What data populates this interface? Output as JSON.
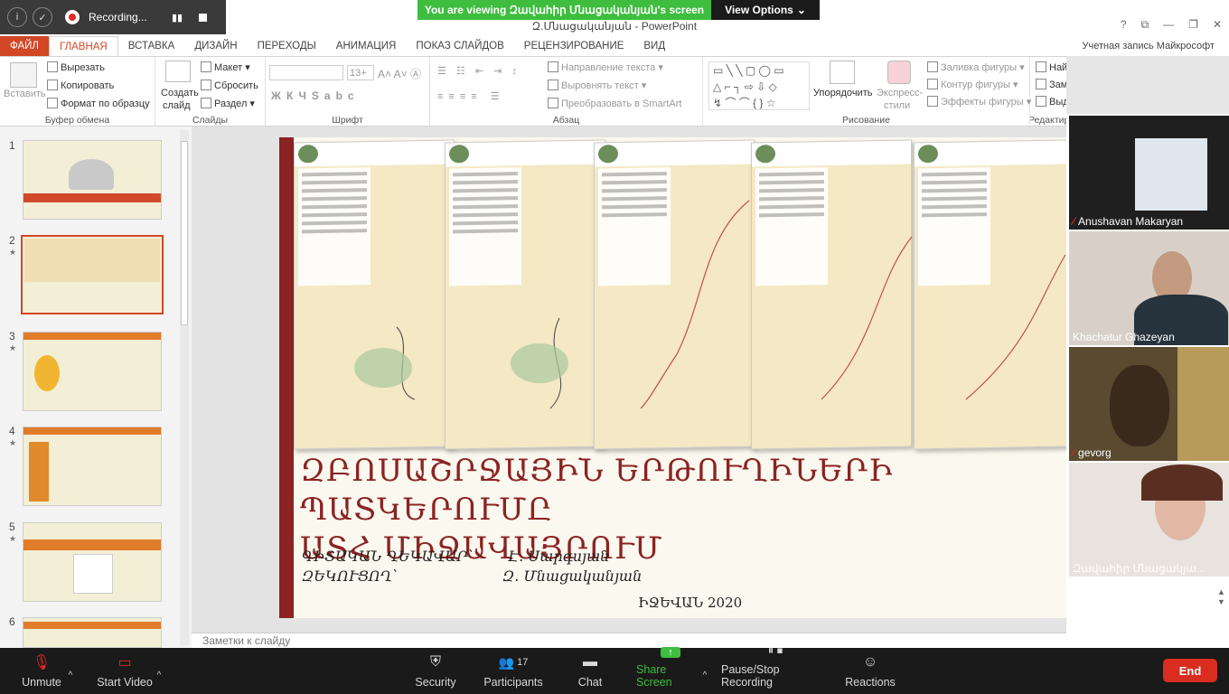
{
  "zoom": {
    "recording_label": "Recording...",
    "banner": "You are viewing Զավահիր Մնացականյան's screen",
    "view_options": "View Options",
    "toolbar": {
      "unmute": "Unmute",
      "start_video": "Start Video",
      "security": "Security",
      "participants": "Participants",
      "participants_count": "17",
      "chat": "Chat",
      "share_screen": "Share Screen",
      "pause_stop": "Pause/Stop Recording",
      "reactions": "Reactions",
      "end": "End"
    },
    "participants": [
      {
        "name": "Anushavan Makaryan",
        "muted": true
      },
      {
        "name": "Khachatur Ghazeyan",
        "muted": false
      },
      {
        "name": "gevorg",
        "muted": true
      },
      {
        "name": "Զավահիր Մնացակյա...",
        "muted": false
      }
    ],
    "accent_green": "#3ebd3e",
    "end_red": "#d92d20"
  },
  "ppt": {
    "doc_title": "Զ.Մնացականյան - PowerPoint",
    "account": "Учетная запись Майкрософт",
    "tabs": [
      "ФАЙЛ",
      "ГЛАВНАЯ",
      "ВСТАВКА",
      "ДИЗАЙН",
      "ПЕРЕХОДЫ",
      "АНИМАЦИЯ",
      "ПОКАЗ СЛАЙДОВ",
      "РЕЦЕНЗИРОВАНИЕ",
      "ВИД"
    ],
    "ribbon": {
      "clipboard": {
        "label": "Буфер обмена",
        "paste": "Вставить",
        "cut": "Вырезать",
        "copy": "Копировать",
        "format": "Формат по образцу"
      },
      "slides": {
        "label": "Слайды",
        "new_slide_1": "Создать",
        "new_slide_2": "слайд",
        "layout": "Макет",
        "reset": "Сбросить",
        "section": "Раздел"
      },
      "font": {
        "label": "Шрифт",
        "size": "13+"
      },
      "paragraph": {
        "label": "Абзац",
        "text_dir": "Направление текста",
        "align_text": "Выровнять текст",
        "smartart": "Преобразовать в SmartArt"
      },
      "drawing": {
        "label": "Рисование",
        "arrange": "Упорядочить",
        "styles_1": "Экспресс-",
        "styles_2": "стили",
        "fill": "Заливка фигуры",
        "outline": "Контур фигуры",
        "effects": "Эффекты фигуры"
      },
      "editing": {
        "label": "Редактир",
        "find": "Найти",
        "replace": "Заменить",
        "select": "Выделить"
      }
    },
    "slide_numbers": [
      "1",
      "2",
      "3",
      "4",
      "5",
      "6"
    ],
    "selected_slide": 2,
    "notes_placeholder": "Заметки к слайду",
    "accent": "#d24726"
  },
  "slide": {
    "title_line1": "ԶԲՈՍԱՇՐՋԱՅԻՆ ԵՐԹՈՒՂԻՆԵՐԻ ՊԱՏԿԵՐՈՒՄԸ",
    "title_line2": "ԱՏՀ ՄԻՋԱՎԱՅՐՈՒՄ",
    "supervisor_label": "ԳԻՏԱԿԱՆ ՂԵԿԱՎԱՐ՝",
    "supervisor_name": "Է. Սարգսյան",
    "author_label": "ԶԵԿՈՒՑՈՂ՝",
    "author_name": "Զ. Մնացականյան",
    "place_year": "ԻՋԵՎԱՆ 2020",
    "title_color": "#8b2323"
  }
}
